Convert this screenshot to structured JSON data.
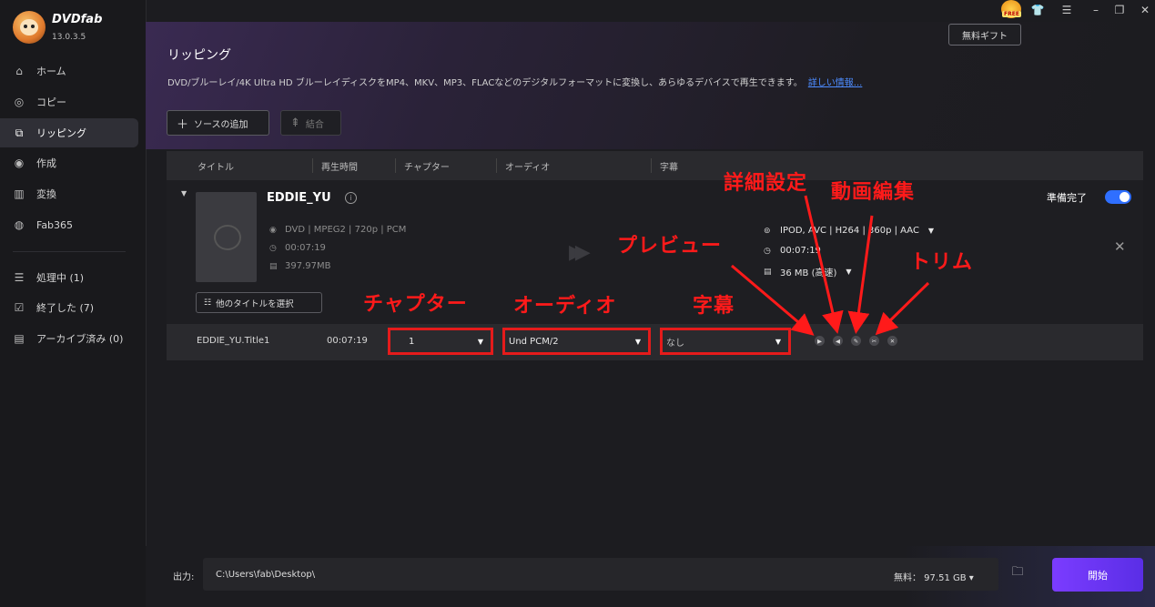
{
  "app": {
    "name": "DVDfab",
    "version": "13.0.3.5"
  },
  "sidebar": {
    "items": [
      {
        "label": "ホーム",
        "icon": "home-icon"
      },
      {
        "label": "コピー",
        "icon": "copy-icon"
      },
      {
        "label": "リッピング",
        "icon": "ripper-icon",
        "active": true
      },
      {
        "label": "作成",
        "icon": "creator-icon"
      },
      {
        "label": "変換",
        "icon": "converter-icon"
      },
      {
        "label": "Fab365",
        "icon": "fab365-icon"
      }
    ],
    "queue": [
      {
        "label": "処理中 (1)",
        "icon": "processing-icon"
      },
      {
        "label": "終了した (7)",
        "icon": "finished-icon"
      },
      {
        "label": "アーカイブ済み (0)",
        "icon": "archive-icon"
      }
    ]
  },
  "topbar": {
    "free_badge": "FREE",
    "gift_button": "無料ギフト",
    "icons": [
      "shirt-icon",
      "menu-icon",
      "minimize-icon",
      "restore-icon",
      "close-icon"
    ]
  },
  "page": {
    "title": "リッピング",
    "description": "DVD/ブルーレイ/4K Ultra HD ブルーレイディスクをMP4、MKV、MP3、FLACなどのデジタルフォーマットに変換し、あらゆるデバイスで再生できます。",
    "more_link": "詳しい情報..."
  },
  "toolbar": {
    "add_source": "ソースの追加",
    "merge": "結合"
  },
  "table": {
    "columns": [
      "タイトル",
      "再生時間",
      "チャプター",
      "オーディオ",
      "字幕"
    ]
  },
  "title_item": {
    "name": "EDDIE_YU",
    "source": {
      "format": "DVD | MPEG2 | 720p | PCM",
      "duration": "00:07:19",
      "size": "397.97MB"
    },
    "output": {
      "profile": "IPOD, AVC | H264 | 360p | AAC",
      "duration": "00:07:19",
      "size": "36 MB (高速)"
    },
    "ready_label": "準備完了",
    "ready_on": true,
    "select_titles": "他のタイトルを選択"
  },
  "track": {
    "name": "EDDIE_YU.Title1",
    "duration": "00:07:19",
    "chapter": "1",
    "audio": "Und  PCM/2",
    "subtitle": "なし"
  },
  "annotations": {
    "chapter": "チャプター",
    "audio": "オーディオ",
    "subtitle": "字幕",
    "preview": "プレビュー",
    "advanced": "詳細設定",
    "edit": "動画編集",
    "trim": "トリム"
  },
  "annotation_color": "#ff1a1a",
  "accent_color": "#2f6fff",
  "start_button_color": "#6a35f2",
  "bottom": {
    "output_label": "出力:",
    "output_path": "C:\\Users\\fab\\Desktop\\",
    "free_space": "無料： 97.51 GB",
    "start": "開始"
  }
}
